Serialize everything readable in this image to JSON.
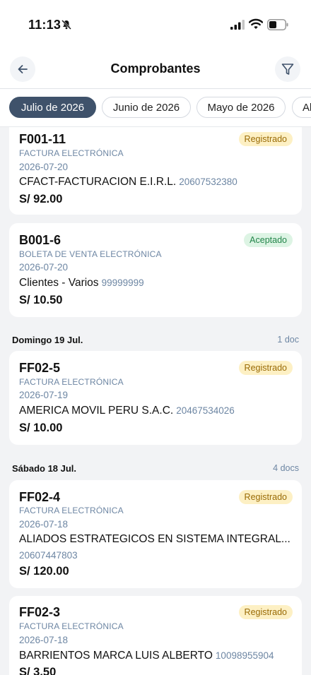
{
  "status_bar": {
    "time": "11:13"
  },
  "header": {
    "title": "Comprobantes"
  },
  "months": [
    "Julio de 2026",
    "Junio de 2026",
    "Mayo de 2026",
    "Al"
  ],
  "cards": [
    {
      "code": "F001-11",
      "status": "Registrado",
      "type": "FACTURA ELECTRÓNICA",
      "date": "2026-07-20",
      "client": "CFACT-FACTURACION E.I.R.L.",
      "ruc": "20607532380",
      "amount": "S/ 92.00"
    },
    {
      "code": "B001-6",
      "status": "Aceptado",
      "type": "BOLETA DE VENTA ELECTRÓNICA",
      "date": "2026-07-20",
      "client": "Clientes - Varios",
      "ruc": "99999999",
      "amount": "S/ 10.50"
    },
    {
      "code": "FF02-5",
      "status": "Registrado",
      "type": "FACTURA ELECTRÓNICA",
      "date": "2026-07-19",
      "client": "AMERICA MOVIL PERU S.A.C.",
      "ruc": "20467534026",
      "amount": "S/ 10.00"
    },
    {
      "code": "FF02-4",
      "status": "Registrado",
      "type": "FACTURA ELECTRÓNICA",
      "date": "2026-07-18",
      "client": "ALIADOS ESTRATEGICOS EN SISTEMA INTEGRAL...",
      "ruc": "20607447803",
      "amount": "S/ 120.00"
    },
    {
      "code": "FF02-3",
      "status": "Registrado",
      "type": "FACTURA ELECTRÓNICA",
      "date": "2026-07-18",
      "client": "BARRIENTOS MARCA LUIS ALBERTO",
      "ruc": "10098955904",
      "amount": "S/ 3.50"
    }
  ],
  "days": [
    {
      "label": "Domingo 19 Jul.",
      "count": "1 doc"
    },
    {
      "label": "Sábado 18 Jul.",
      "count": "4 docs"
    }
  ],
  "colors": {
    "accent": "#3f526b",
    "muted": "#6d86a3",
    "registered_bg": "#fdf0c4",
    "accepted_bg": "#ddf4e4"
  }
}
